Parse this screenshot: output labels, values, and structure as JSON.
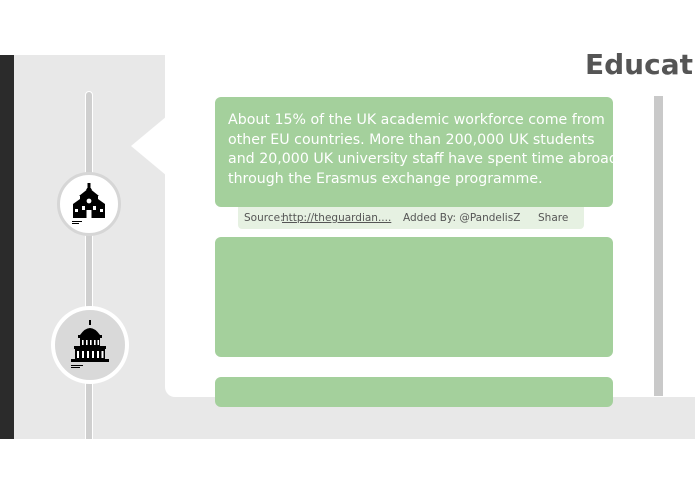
{
  "page": {
    "title": "Educati"
  },
  "timeline": {
    "nodes": [
      {
        "icon": "school-building-icon"
      },
      {
        "icon": "parliament-dome-icon"
      }
    ]
  },
  "cards": [
    {
      "text": "About 15% of the UK academic workforce come from other EU countries. More than 200,000 UK students and 20,000 UK university staff have spent time abroad through the Erasmus exchange programme.",
      "source_label": "Source:",
      "source_link": "http://theguardian....",
      "added_by": "Added By: @PandelisZ",
      "share_label": "Share"
    },
    {
      "text": ""
    },
    {
      "text": ""
    }
  ],
  "colors": {
    "card": "#a4d09c",
    "meta_bar": "#e6f1e2",
    "title": "#555555",
    "background": "#e8e8e8"
  }
}
